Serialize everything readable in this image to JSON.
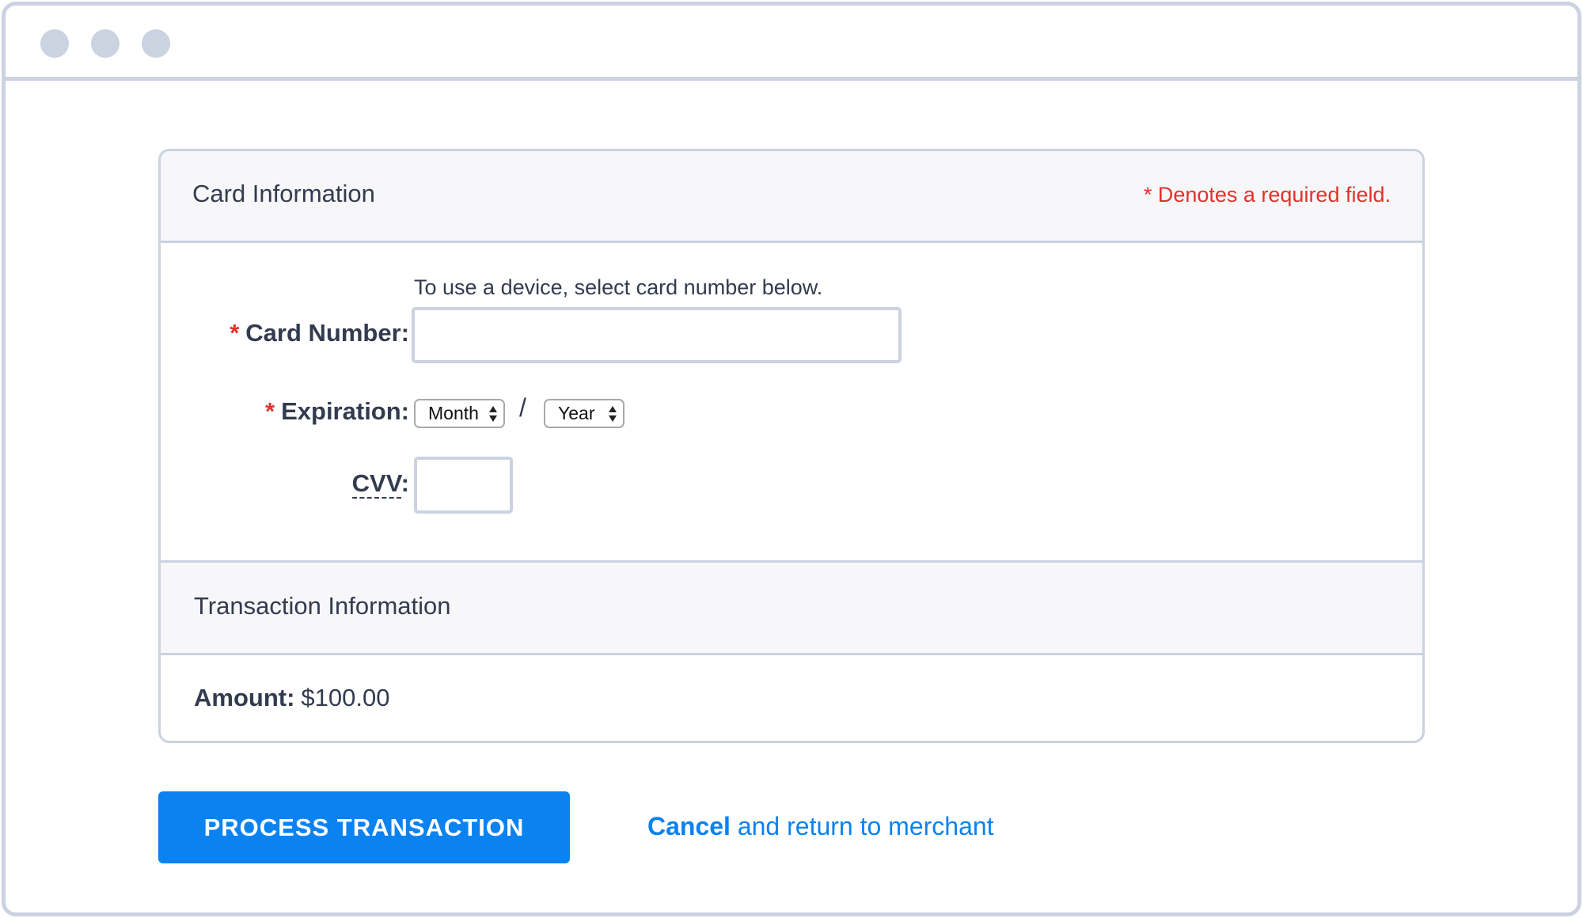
{
  "window": {
    "controls": [
      "close-dot",
      "minimize-dot",
      "maximize-dot"
    ]
  },
  "card_section": {
    "title": "Card Information",
    "required_note": "* Denotes a required field.",
    "hint": "To use a device, select card number below.",
    "card_number": {
      "required_marker": "*",
      "label": "Card Number:",
      "value": "",
      "placeholder": ""
    },
    "expiration": {
      "required_marker": "*",
      "label": "Expiration:",
      "month_selected": "Month",
      "separator": "/",
      "year_selected": "Year"
    },
    "cvv": {
      "label": "CVV",
      "label_suffix": ":",
      "value": "",
      "placeholder": ""
    }
  },
  "transaction_section": {
    "title": "Transaction Information",
    "amount_label": "Amount:",
    "amount_value": "$100.00"
  },
  "actions": {
    "process_label": "PROCESS TRANSACTION",
    "cancel_strong": "Cancel",
    "cancel_rest": " and return to merchant"
  },
  "colors": {
    "accent": "#0a82f0",
    "required": "#e0322a",
    "border": "#cbd2e0",
    "header_bg": "#f7f7f9",
    "text": "#333b4f"
  }
}
